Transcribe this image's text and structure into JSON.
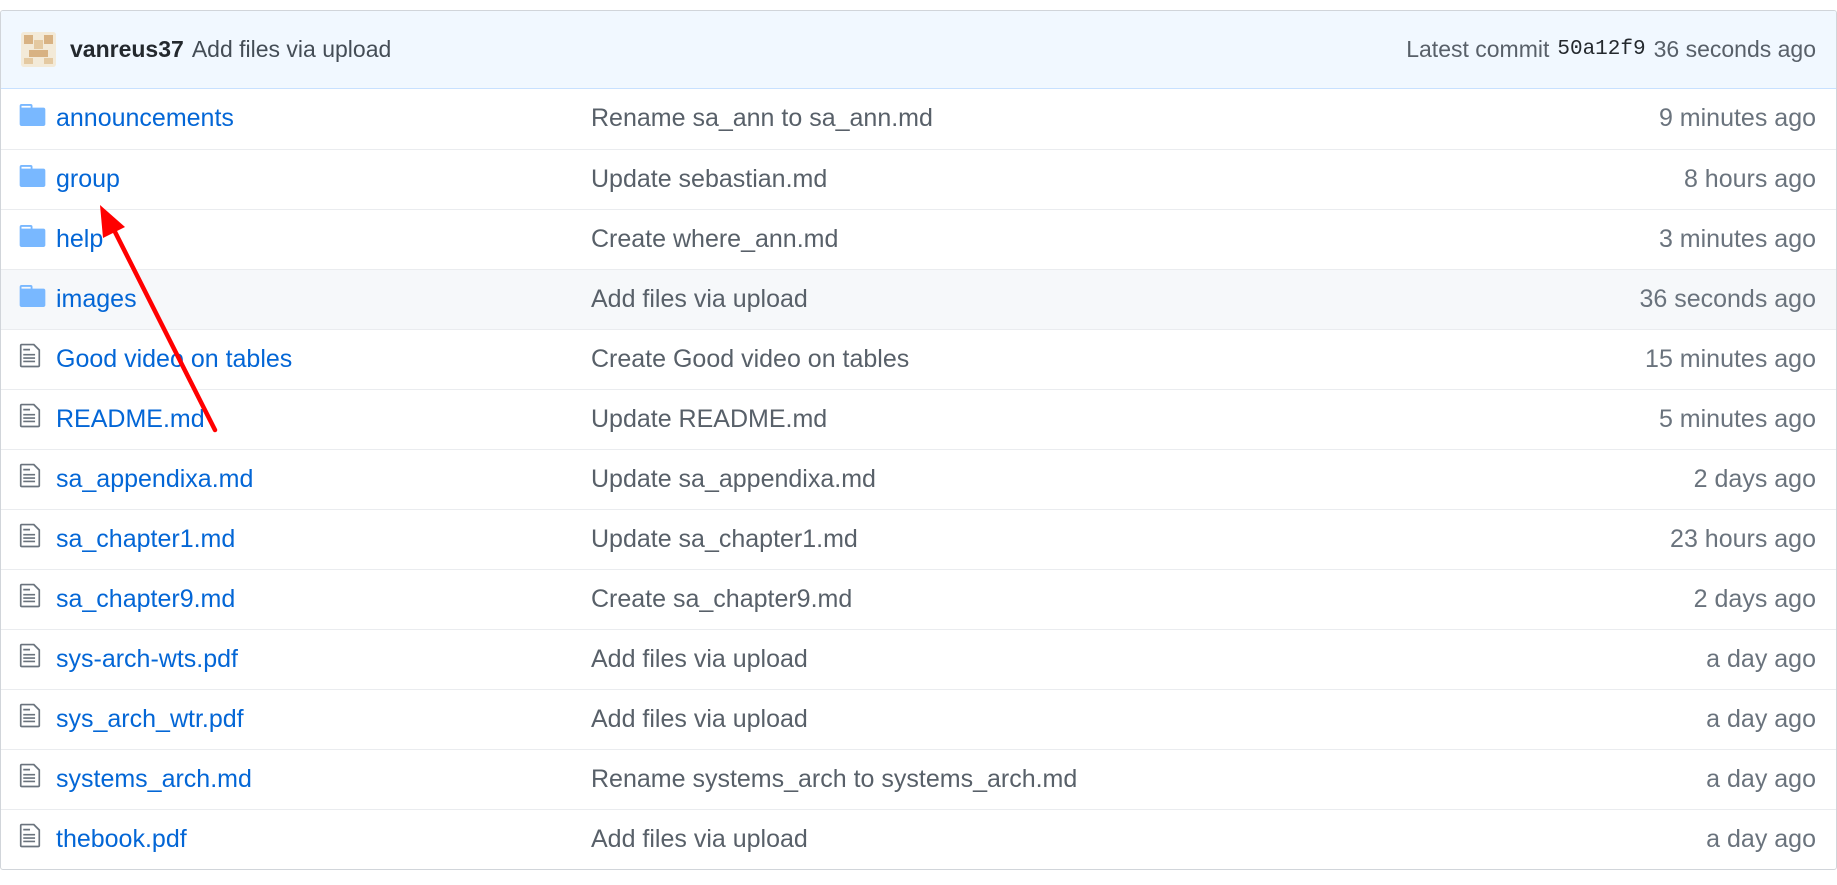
{
  "commit": {
    "author": "vanreus37",
    "message": "Add files via upload",
    "prefix": "Latest commit",
    "sha": "50a12f9",
    "age": "36 seconds ago"
  },
  "files": [
    {
      "type": "dir",
      "icon": "folder-icon",
      "name": "announcements",
      "message": "Rename sa_ann to sa_ann.md",
      "age": "9 minutes ago"
    },
    {
      "type": "dir",
      "icon": "folder-icon",
      "name": "group",
      "message": "Update sebastian.md",
      "age": "8 hours ago"
    },
    {
      "type": "dir",
      "icon": "folder-icon",
      "name": "help",
      "message": "Create where_ann.md",
      "age": "3 minutes ago"
    },
    {
      "type": "dir",
      "icon": "folder-icon",
      "name": "images",
      "message": "Add files via upload",
      "age": "36 seconds ago"
    },
    {
      "type": "file",
      "icon": "file-icon",
      "name": "Good video on tables",
      "message": "Create Good video on tables",
      "age": "15 minutes ago"
    },
    {
      "type": "file",
      "icon": "file-icon",
      "name": "README.md",
      "message": "Update README.md",
      "age": "5 minutes ago"
    },
    {
      "type": "file",
      "icon": "file-icon",
      "name": "sa_appendixa.md",
      "message": "Update sa_appendixa.md",
      "age": "2 days ago"
    },
    {
      "type": "file",
      "icon": "file-icon",
      "name": "sa_chapter1.md",
      "message": "Update sa_chapter1.md",
      "age": "23 hours ago"
    },
    {
      "type": "file",
      "icon": "file-icon",
      "name": "sa_chapter9.md",
      "message": "Create sa_chapter9.md",
      "age": "2 days ago"
    },
    {
      "type": "file",
      "icon": "file-icon",
      "name": "sys-arch-wts.pdf",
      "message": "Add files via upload",
      "age": "a day ago"
    },
    {
      "type": "file",
      "icon": "file-icon",
      "name": "sys_arch_wtr.pdf",
      "message": "Add files via upload",
      "age": "a day ago"
    },
    {
      "type": "file",
      "icon": "file-icon",
      "name": "systems_arch.md",
      "message": "Rename systems_arch to systems_arch.md",
      "age": "a day ago"
    },
    {
      "type": "file",
      "icon": "file-icon",
      "name": "thebook.pdf",
      "message": "Add files via upload",
      "age": "a day ago"
    }
  ],
  "colors": {
    "link": "#0366d6",
    "folder": "#79b8ff",
    "annotation_arrow": "#ff0000"
  }
}
